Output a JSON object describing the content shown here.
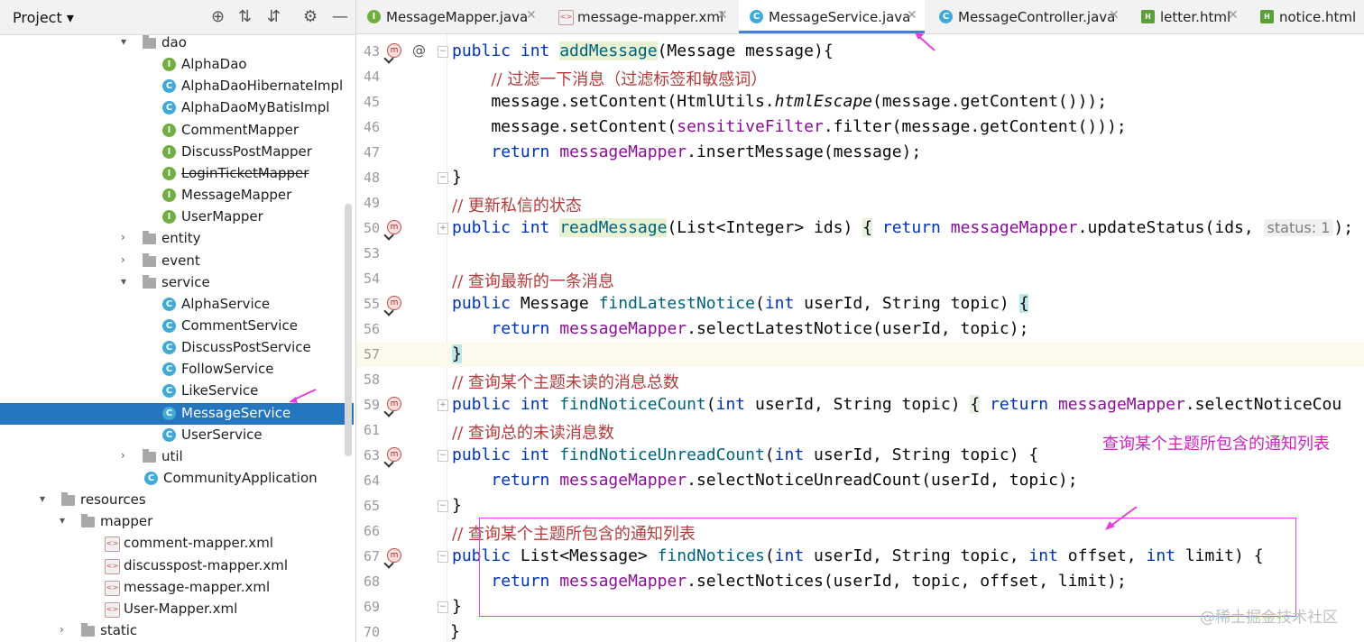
{
  "project": {
    "title": "Project",
    "tree": [
      {
        "label": "dao",
        "type": "folder",
        "arrow": "▾"
      },
      {
        "label": "AlphaDao",
        "type": "interface"
      },
      {
        "label": "AlphaDaoHibernateImpl",
        "type": "class"
      },
      {
        "label": "AlphaDaoMyBatisImpl",
        "type": "class"
      },
      {
        "label": "CommentMapper",
        "type": "interface"
      },
      {
        "label": "DiscussPostMapper",
        "type": "interface"
      },
      {
        "label": "LoginTicketMapper",
        "type": "interface",
        "deprecated": true
      },
      {
        "label": "MessageMapper",
        "type": "interface"
      },
      {
        "label": "UserMapper",
        "type": "interface"
      },
      {
        "label": "entity",
        "type": "folder",
        "arrow": "›"
      },
      {
        "label": "event",
        "type": "folder",
        "arrow": "›"
      },
      {
        "label": "service",
        "type": "folder",
        "arrow": "▾"
      },
      {
        "label": "AlphaService",
        "type": "class"
      },
      {
        "label": "CommentService",
        "type": "class"
      },
      {
        "label": "DiscussPostService",
        "type": "class"
      },
      {
        "label": "FollowService",
        "type": "class"
      },
      {
        "label": "LikeService",
        "type": "class"
      },
      {
        "label": "MessageService",
        "type": "class",
        "selected": true
      },
      {
        "label": "UserService",
        "type": "class"
      },
      {
        "label": "util",
        "type": "folder",
        "arrow": "›"
      },
      {
        "label": "CommunityApplication",
        "type": "class"
      },
      {
        "label": "resources",
        "type": "folder",
        "arrow": "▾"
      },
      {
        "label": "mapper",
        "type": "folder",
        "arrow": "▾"
      },
      {
        "label": "comment-mapper.xml",
        "type": "xml"
      },
      {
        "label": "discusspost-mapper.xml",
        "type": "xml"
      },
      {
        "label": "message-mapper.xml",
        "type": "xml"
      },
      {
        "label": "User-Mapper.xml",
        "type": "xml"
      },
      {
        "label": "static",
        "type": "folder",
        "arrow": "›"
      }
    ]
  },
  "tabs": [
    {
      "label": "MessageMapper.java",
      "icon": "interface",
      "active": false
    },
    {
      "label": "message-mapper.xml",
      "icon": "xml",
      "active": false
    },
    {
      "label": "MessageService.java",
      "icon": "class",
      "active": true
    },
    {
      "label": "MessageController.java",
      "icon": "class",
      "active": false
    },
    {
      "label": "letter.html",
      "icon": "html",
      "active": false
    },
    {
      "label": "notice.html",
      "icon": "html",
      "active": false
    }
  ],
  "editor": {
    "lines": [
      "43",
      "44",
      "45",
      "46",
      "47",
      "48",
      "49",
      "50",
      "53",
      "54",
      "55",
      "56",
      "57",
      "58",
      "59",
      "61",
      "63",
      "64",
      "65",
      "66",
      "67",
      "68",
      "69",
      "70"
    ],
    "comments": {
      "l44": "// 过滤一下消息（过滤标签和敏感词）",
      "l49": "// 更新私信的状态",
      "l54": "// 查询最新的一条消息",
      "l58": "// 查询某个主题未读的消息总数",
      "l61": "// 查询总的未读消息数",
      "l66": "// 查询某个主题所包含的通知列表"
    },
    "hint_status": "status: 1"
  },
  "annotation": {
    "note": "查询某个主题所包含的通知列表",
    "color": "#e43fd8"
  },
  "watermark": "@稀土掘金技术社区"
}
